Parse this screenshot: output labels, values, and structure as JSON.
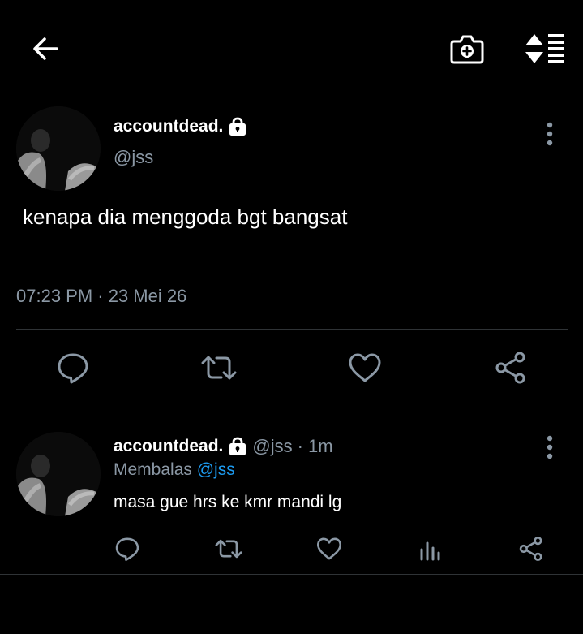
{
  "colors": {
    "background": "#000000",
    "text": "#ffffff",
    "secondary_text": "#8b98a5",
    "link": "#1d9bf0",
    "divider": "#2f3336"
  },
  "top_bar": {
    "icons": [
      "back-arrow-icon",
      "camera-plus-icon",
      "sort-icon"
    ]
  },
  "main_tweet": {
    "display_name": "accountdead.",
    "handle": "@jss",
    "text": "kenapa dia menggoda bgt bangsat",
    "timestamp": "07:23 PM · 23 Mei 26",
    "actions": [
      "reply-icon",
      "retweet-icon",
      "like-icon",
      "share-icon"
    ]
  },
  "reply_tweet": {
    "display_name": "accountdead.",
    "handle": "@jss",
    "time_ago": "· 1m",
    "replying_to_label": "Membalas",
    "replying_to_handle": "@jss",
    "text": "masa gue hrs ke kmr mandi lg",
    "actions": [
      "reply-icon",
      "retweet-icon",
      "like-icon",
      "stats-icon",
      "share-icon"
    ]
  }
}
